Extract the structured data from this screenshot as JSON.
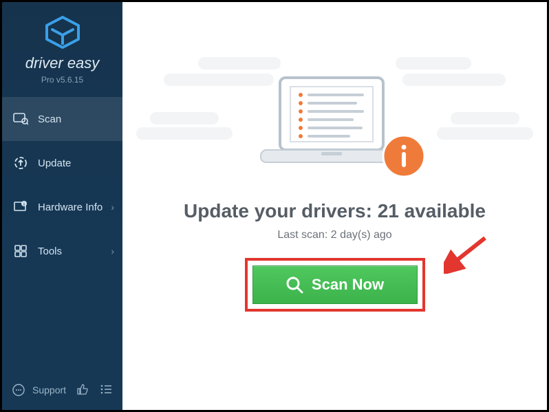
{
  "brand": {
    "name": "driver easy",
    "version": "Pro v5.6.15"
  },
  "sidebar": {
    "items": [
      {
        "label": "Scan"
      },
      {
        "label": "Update"
      },
      {
        "label": "Hardware Info"
      },
      {
        "label": "Tools"
      }
    ],
    "support": "Support"
  },
  "main": {
    "headline_prefix": "Update your drivers: ",
    "available_count": 21,
    "headline_suffix": " available",
    "last_scan": "Last scan: 2 day(s) ago",
    "scan_button": "Scan Now"
  },
  "colors": {
    "accent_orange": "#ef7b3a",
    "scan_green": "#46c055",
    "highlight_red": "#e2362f"
  }
}
